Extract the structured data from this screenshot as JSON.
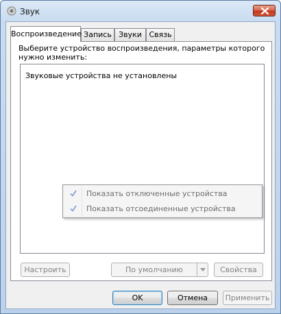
{
  "window": {
    "title": "Звук",
    "icon": "speaker-icon",
    "close_icon": "close-icon"
  },
  "tabs": [
    {
      "label": "Воспроизведение",
      "active": true
    },
    {
      "label": "Запись",
      "active": false
    },
    {
      "label": "Звуки",
      "active": false
    },
    {
      "label": "Связь",
      "active": false
    }
  ],
  "playback": {
    "instruction": "Выберите устройство воспроизведения, параметры которого нужно изменить:",
    "empty_text": "Звуковые устройства не установлены"
  },
  "context_menu": {
    "items": [
      {
        "label": "Показать отключенные устройства",
        "checked": true
      },
      {
        "label": "Показать отсоединенные устройства",
        "checked": true
      }
    ]
  },
  "panel_buttons": {
    "configure": "Настроить",
    "set_default": "По умолчанию",
    "properties": "Свойства"
  },
  "dialog_buttons": {
    "ok": "OK",
    "cancel": "Отмена",
    "apply": "Применить"
  },
  "colors": {
    "accent": "#3c7fb1",
    "check": "#7a9ad6",
    "close": "#c2391c"
  }
}
